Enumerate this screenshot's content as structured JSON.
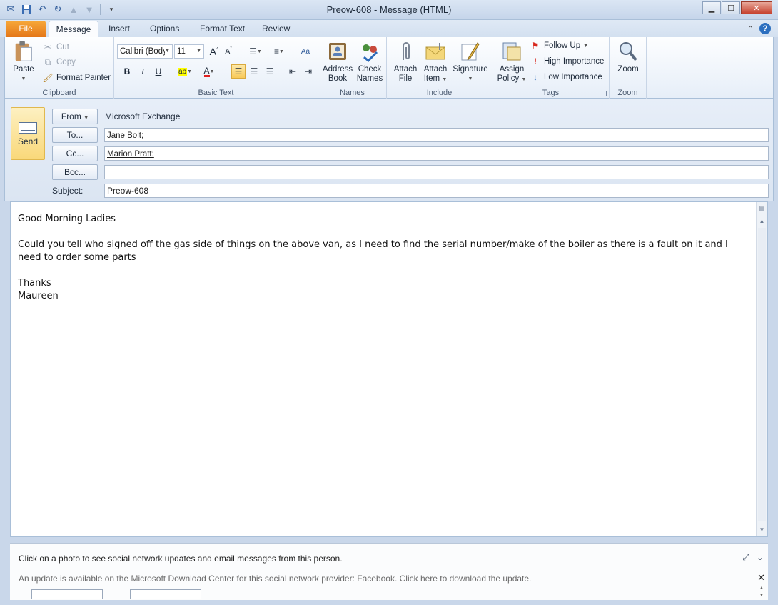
{
  "window": {
    "title": "Preow-608  -  Message (HTML)"
  },
  "tabs": [
    {
      "label": "File"
    },
    {
      "label": "Message"
    },
    {
      "label": "Insert"
    },
    {
      "label": "Options"
    },
    {
      "label": "Format Text"
    },
    {
      "label": "Review"
    }
  ],
  "ribbon": {
    "clipboard": {
      "paste": "Paste",
      "cut": "Cut",
      "copy": "Copy",
      "format_painter": "Format Painter",
      "label": "Clipboard"
    },
    "basic_text": {
      "font": "Calibri (Body)",
      "size": "11",
      "label": "Basic Text"
    },
    "names": {
      "address_book_1": "Address",
      "address_book_2": "Book",
      "check_names_1": "Check",
      "check_names_2": "Names",
      "label": "Names"
    },
    "include": {
      "attach_file_1": "Attach",
      "attach_file_2": "File",
      "attach_item_1": "Attach",
      "attach_item_2": "Item",
      "signature": "Signature",
      "label": "Include"
    },
    "tags": {
      "assign_policy_1": "Assign",
      "assign_policy_2": "Policy",
      "follow_up": "Follow Up",
      "high_importance": "High Importance",
      "low_importance": "Low Importance",
      "label": "Tags"
    },
    "zoom": {
      "zoom": "Zoom",
      "label": "Zoom"
    }
  },
  "compose": {
    "send": "Send",
    "from_button": "From",
    "from_value": "Microsoft Exchange",
    "to_button": "To...",
    "to_value": "Jane Bolt;",
    "cc_button": "Cc...",
    "cc_value": "Marion Pratt;",
    "bcc_button": "Bcc...",
    "bcc_value": "",
    "subject_label": "Subject:",
    "subject_value": "Preow-608"
  },
  "body": {
    "line1": "Good Morning Ladies",
    "line2": "Could you tell who signed off the gas side of things on the above van, as I need to find the serial number/make of the boiler as there is a fault on it and I need to order some parts",
    "line3": "Thanks",
    "line4": "Maureen"
  },
  "people_pane": {
    "hint": "Click on a photo to see social network updates and email messages from this person.",
    "update": "An update is available on the Microsoft Download Center for this social network provider: Facebook. Click here to download the update."
  }
}
